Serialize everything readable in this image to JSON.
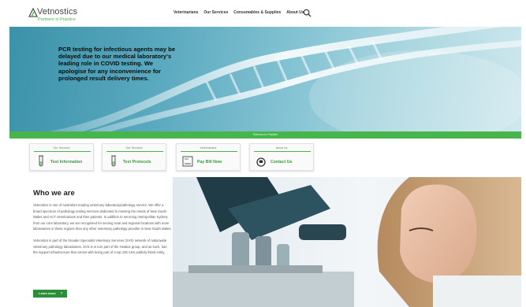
{
  "header": {
    "logo_name": "Vetnostics",
    "logo_tagline": "Partners in Practice",
    "nav": [
      "Veterinarians",
      "Our Services",
      "Consumables & Supplies",
      "About Us"
    ]
  },
  "hero": {
    "notice": "PCR testing for infectious agents may be delayed due to our medical laboratory's leading role in COVID testing. We apologise for any inconvenience for prolonged result delivery times.",
    "bar_text": "Partners in Practice"
  },
  "cards": [
    {
      "category": "Our Services",
      "title": "Test Information",
      "icon": "test-tube-icon"
    },
    {
      "category": "Our Services",
      "title": "Test Protocols",
      "icon": "test-tube-icon"
    },
    {
      "category": "Veterinarians",
      "title": "Pay Bill Now",
      "icon": "invoice-icon"
    },
    {
      "category": "About Us",
      "title": "Contact Us",
      "icon": "phone-icon"
    }
  ],
  "who": {
    "heading": "Who we are",
    "para1": "Vetnostics is one of Australia's leading veterinary laboratory/pathology service. We offer a broad spectrum of pathology testing services dedicated to meeting the needs of New South Wales and ACT veterinarians and their patients. In addition to servicing metropolitan Sydney from our core laboratory, we are recognised for serving rural and regional locations with more laboratories in these regions than any other veterinary pathology provider in New South Wales.",
    "para2": "Vetnostics is part of the broader Specialist Veterinary Services (SVS) network of nationwide veterinary pathology laboratories. SVS is in turn part of the Healius group, and as such, has the support infrastructure that comes with being part of a top 100 ASX publicly listed entity.",
    "button": "Learn more",
    "button_arrow": "›"
  },
  "colors": {
    "brand_green": "#47b54b",
    "button_green": "#2b8f3a",
    "hero_blue": "#5aa9bf"
  }
}
